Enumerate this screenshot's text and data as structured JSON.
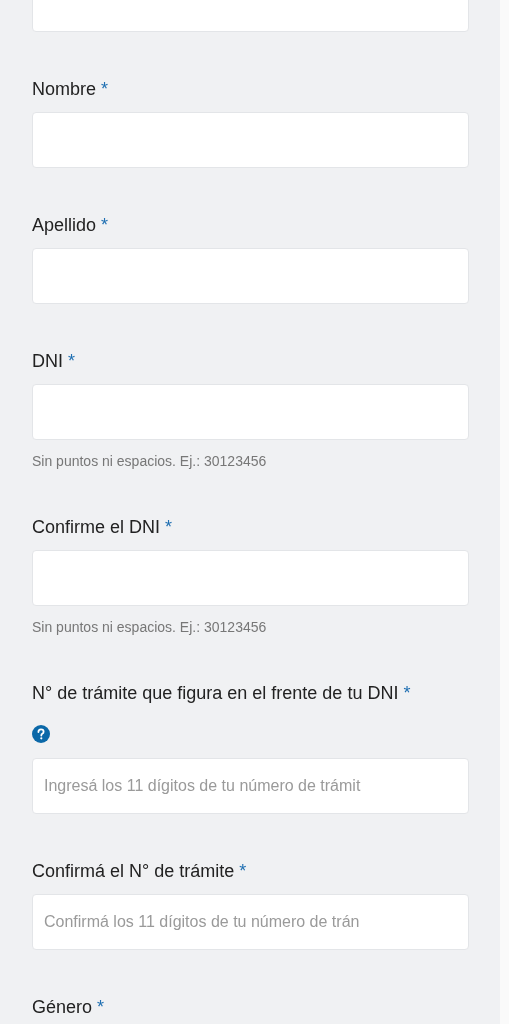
{
  "fields": [
    {
      "kind": "input"
    },
    {
      "kind": "input",
      "label": "Nombre",
      "required": "*"
    },
    {
      "kind": "input",
      "label": "Apellido",
      "required": "*"
    },
    {
      "kind": "input",
      "label": "DNI",
      "required": "*",
      "hint": "Sin puntos ni espacios. Ej.: 30123456"
    },
    {
      "kind": "input",
      "label": "Confirme el DNI",
      "required": "*",
      "hint": "Sin puntos ni espacios. Ej.: 30123456"
    },
    {
      "kind": "input",
      "label": "N° de trámite que figura en el frente de tu DNI",
      "required": "*",
      "help": true,
      "placeholder": "Ingresá los 11 dígitos de tu número de trámit"
    },
    {
      "kind": "input",
      "label": "Confirmá el N° de trámite",
      "required": "*",
      "placeholder": "Confirmá los 11 dígitos de tu número de trán"
    },
    {
      "kind": "label",
      "label": "Género",
      "required": "*"
    }
  ]
}
